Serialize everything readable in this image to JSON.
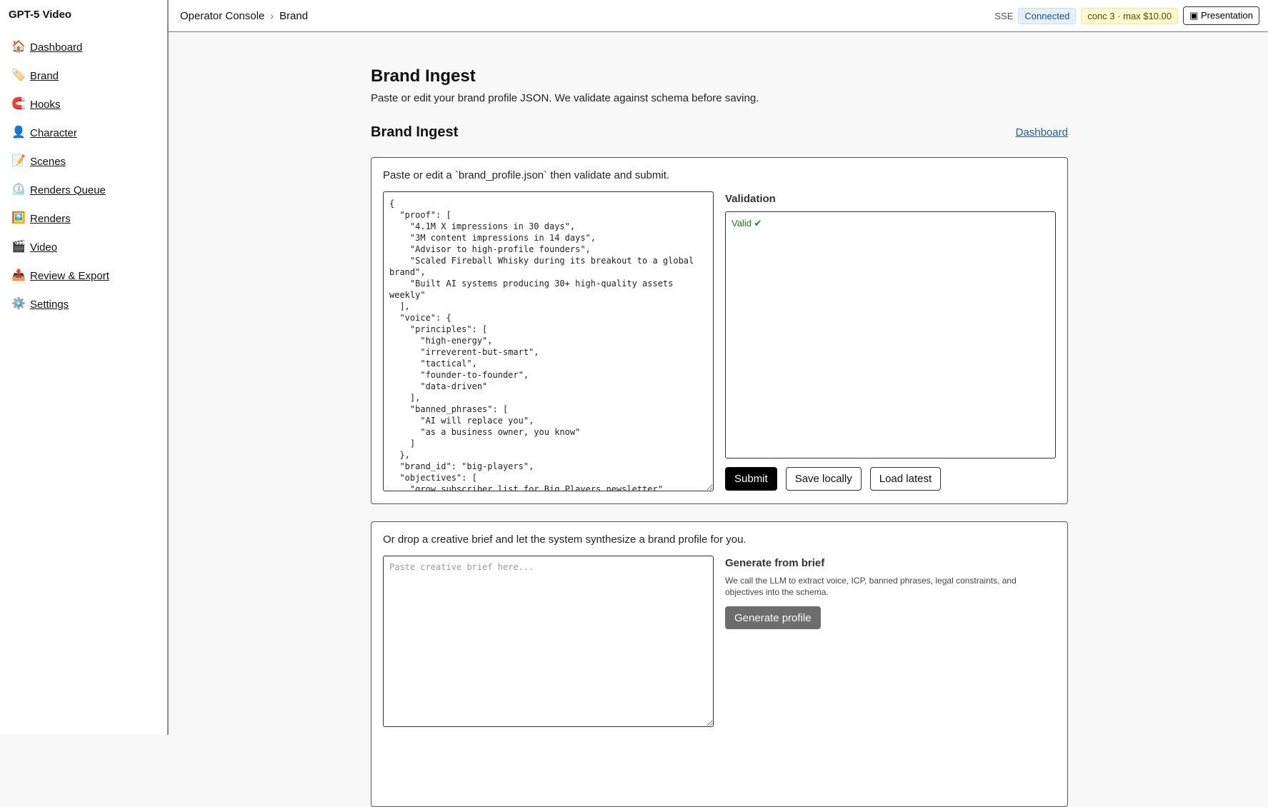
{
  "app": {
    "title": "GPT-5 Video"
  },
  "sidebar": {
    "items": [
      {
        "label": "Dashboard",
        "icon": "🏠"
      },
      {
        "label": "Brand",
        "icon": "🏷️"
      },
      {
        "label": "Hooks",
        "icon": "🧲"
      },
      {
        "label": "Character",
        "icon": "👤"
      },
      {
        "label": "Scenes",
        "icon": "📝"
      },
      {
        "label": "Renders Queue",
        "icon": "⏲️"
      },
      {
        "label": "Renders",
        "icon": "🖼️"
      },
      {
        "label": "Video",
        "icon": "🎬"
      },
      {
        "label": "Review & Export",
        "icon": "📤"
      },
      {
        "label": "Settings",
        "icon": "⚙️"
      }
    ]
  },
  "header": {
    "breadcrumb": [
      "Operator Console",
      "Brand"
    ],
    "breadcrumb_sep": "›",
    "sse_label": "SSE",
    "connection_status": "Connected",
    "concurrency": "conc 3 · max $10.00",
    "presentation_label": "▣ Presentation"
  },
  "page": {
    "title": "Brand Ingest",
    "subtitle": "Paste or edit your brand profile JSON. We validate against schema before saving.",
    "section_title": "Brand Ingest",
    "dashboard_link": "Dashboard"
  },
  "ingest": {
    "intro": "Paste or edit a `brand_profile.json` then validate and submit.",
    "json_value": "{\n  \"proof\": [\n    \"4.1M X impressions in 30 days\",\n    \"3M content impressions in 14 days\",\n    \"Advisor to high-profile founders\",\n    \"Scaled Fireball Whisky during its breakout to a global brand\",\n    \"Built AI systems producing 30+ high-quality assets weekly\"\n  ],\n  \"voice\": {\n    \"principles\": [\n      \"high-energy\",\n      \"irreverent-but-smart\",\n      \"tactical\",\n      \"founder-to-founder\",\n      \"data-driven\"\n    ],\n    \"banned_phrases\": [\n      \"AI will replace you\",\n      \"as a business owner, you know\"\n    ]\n  },\n  \"brand_id\": \"big-players\",\n  \"objectives\": [\n    \"grow subscriber list for Big Players newsletter\"",
    "validation_label": "Validation",
    "validation_result": "Valid ✔",
    "submit_label": "Submit",
    "save_label": "Save locally",
    "load_label": "Load latest"
  },
  "brief": {
    "intro": "Or drop a creative brief and let the system synthesize a brand profile for you.",
    "placeholder": "Paste creative brief here...",
    "gen_title": "Generate from brief",
    "gen_desc": "We call the LLM to extract voice, ICP, banned phrases, legal constraints, and objectives into the schema.",
    "gen_button": "Generate profile"
  }
}
